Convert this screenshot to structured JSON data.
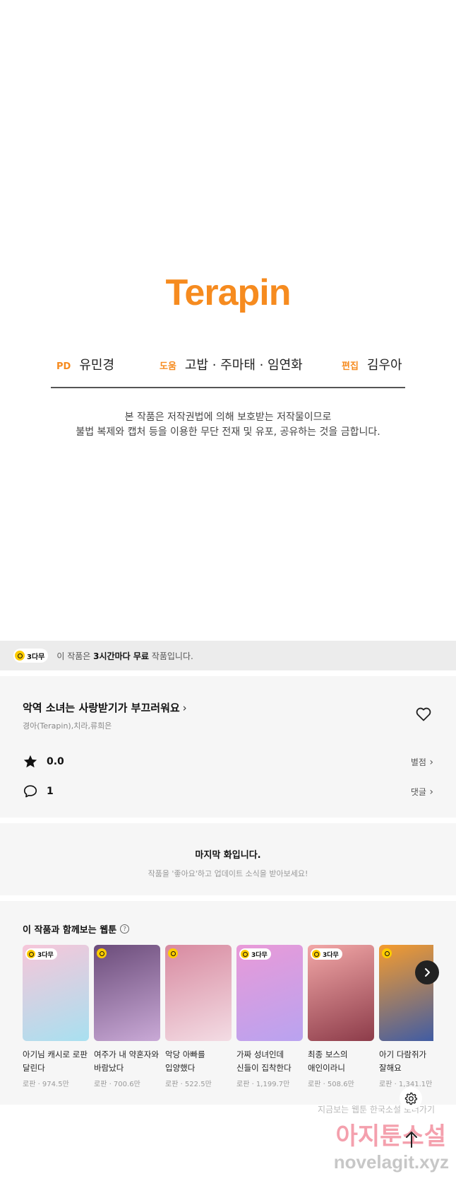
{
  "credits": {
    "logo_text": "Terapin",
    "pd_role": "PD",
    "pd_name": "유민경",
    "help_role": "도움",
    "help_names": "고밥 · 주마태 · 임연화",
    "edit_role": "편집",
    "edit_name": "김우아",
    "notice_line1": "본 작품은 저작권법에 의해 보호받는 저작물이므로",
    "notice_line2": "불법 복제와 캡처 등을 이용한 무단 전재 및 유포, 공유하는 것을 금합니다."
  },
  "free_banner": {
    "badge": "3다무",
    "prefix": "이 작품은",
    "emphasis": "3시간마다 무료",
    "suffix": "작품입니다."
  },
  "info": {
    "title": "악역 소녀는 사랑받기가 부끄러워요",
    "authors": "경아(Terapin),치라,류희은",
    "rating": "0.0",
    "rating_link": "별점",
    "comments": "1",
    "comments_link": "댓글"
  },
  "last_episode": {
    "heading": "마지막 화입니다.",
    "sub": "작품을 '좋아요'하고 업데이트 소식을 받아보세요!"
  },
  "recs": {
    "title": "이 작품과 함께보는 웹툰",
    "items": [
      {
        "badge": "3다무",
        "title": "아기님 캐시로 로판 달린다",
        "meta": "로판 · 974.5만",
        "colors": [
          "#f7c6d9",
          "#a8e0f0"
        ]
      },
      {
        "badge": "",
        "title": "여주가 내 약혼자와 바람났다",
        "meta": "로판 · 700.6만",
        "colors": [
          "#6b4c7a",
          "#c9a9d6"
        ]
      },
      {
        "badge": "",
        "title": "악당 아빠를 입양했다",
        "meta": "로판 · 522.5만",
        "colors": [
          "#d88aa0",
          "#f3dce4"
        ]
      },
      {
        "badge": "3다무",
        "title": "가짜 성녀인데 신들이 집착한다",
        "meta": "로판 · 1,199.7만",
        "colors": [
          "#e99ad8",
          "#b9a3f0"
        ]
      },
      {
        "badge": "3다무",
        "title": "최종 보스의 애인이라니 오해입...",
        "meta": "로판 · 508.6만",
        "colors": [
          "#f2a7a7",
          "#8d3c4a"
        ]
      },
      {
        "badge": "",
        "title": "아기 다람쥐가 잘해요",
        "meta": "로판 · 1,341.1만",
        "colors": [
          "#f59c2e",
          "#3a5aa8"
        ]
      }
    ]
  },
  "watermark": {
    "line1": "지금보는 웹툰 한국소설 보러가기",
    "line2": "아지툰소설",
    "line3": "novelagit.xyz"
  },
  "icons": {
    "heart": "heart-outline-icon",
    "star": "star-icon",
    "comment": "comment-icon",
    "next": "chevron-right-icon",
    "settings": "gear-icon",
    "top": "arrow-up-icon"
  },
  "colors": {
    "brand": "#f68b1f",
    "badge_yellow": "#ffcc00",
    "section_bg": "#f6f6f6"
  }
}
